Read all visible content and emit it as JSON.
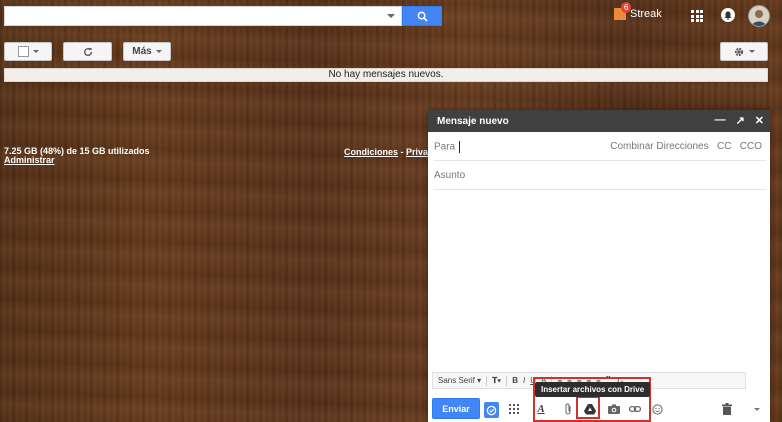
{
  "search": {
    "value": "",
    "placeholder": ""
  },
  "header": {
    "streak_label": "Streak",
    "streak_count": "6"
  },
  "toolbar": {
    "more_label": "Más"
  },
  "inbox": {
    "empty_message": "No hay mensajes nuevos."
  },
  "footer": {
    "storage": "7.25 GB (48%) de 15 GB utilizados",
    "manage": "Administrar",
    "terms": "Condiciones",
    "separator": " - ",
    "privacy": "Privacidad"
  },
  "compose": {
    "title": "Mensaje nuevo",
    "to_label": "Para",
    "merge_label": "Combinar Direcciones",
    "cc_label": "CC",
    "bcc_label": "CCO",
    "subject_placeholder": "Asunto",
    "font_family": "Sans Serif",
    "send_label": "Enviar",
    "drive_tooltip": "Insertar archivos con Drive"
  },
  "colors": {
    "primary_blue": "#4285f4",
    "highlight_red": "#d0312d",
    "compose_header": "#404040"
  }
}
